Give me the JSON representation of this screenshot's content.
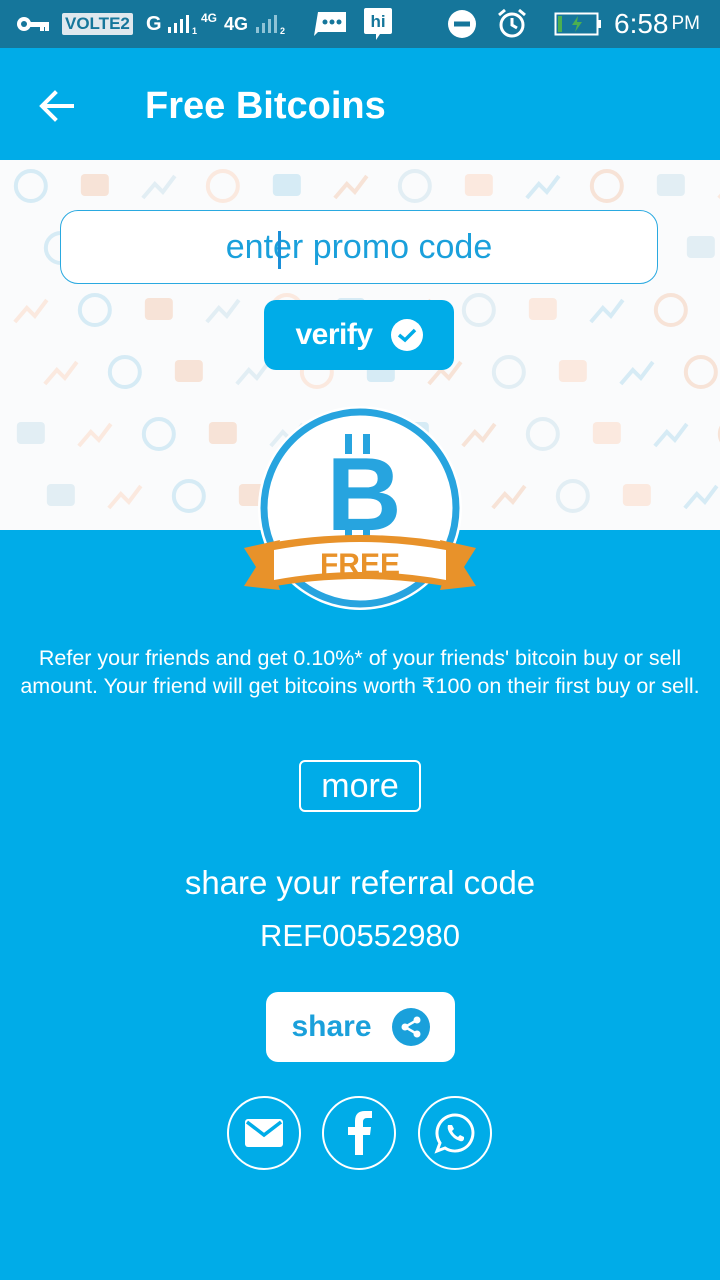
{
  "status_bar": {
    "carrier_badge": "VOLTE2",
    "network_g": "G",
    "network_4g_small": "4G",
    "network_4g": "4G",
    "notification_app": "hi",
    "time": "6:58",
    "ampm": "PM"
  },
  "appbar": {
    "title": "Free Bitcoins"
  },
  "promo": {
    "placeholder": "enter promo code",
    "verify_label": "verify"
  },
  "badge": {
    "ribbon_text": "FREE",
    "symbol": "B"
  },
  "referral": {
    "description": "Refer your friends and get 0.10%* of your friends' bitcoin buy or sell amount. Your friend will get bitcoins worth ₹100 on their first buy or sell.",
    "more_label": "more",
    "share_heading": "share your referral code",
    "code": "REF00552980",
    "share_label": "share"
  },
  "social": [
    "email-icon",
    "facebook-icon",
    "whatsapp-icon"
  ],
  "colors": {
    "primary": "#00ace8",
    "status_bar": "#15769b",
    "ribbon": "#e8922a"
  }
}
